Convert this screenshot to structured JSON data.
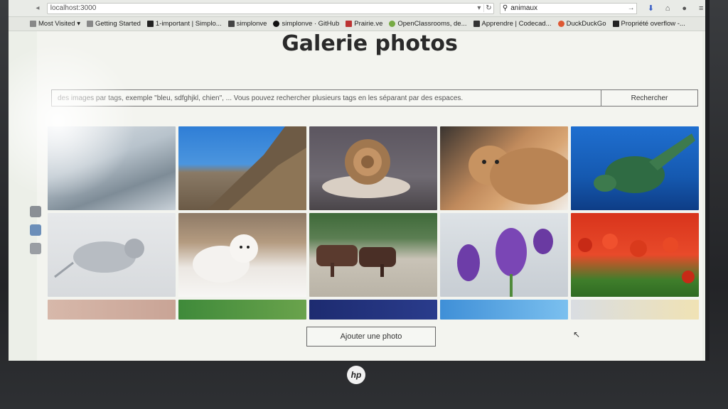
{
  "browser": {
    "url": "localhost:3000",
    "search_value": "animaux",
    "bookmarks": [
      "Most Visited",
      "Getting Started",
      "1-important | Simplo...",
      "simplonve",
      "simplonve · GitHub",
      "Prairie.ve",
      "OpenClassrooms, de...",
      "Apprendre | Codecad...",
      "DuckDuckGo",
      "Propriété overflow -..."
    ]
  },
  "page": {
    "title": "Galerie photos",
    "search_placeholder": "des images par tags, exemple \"bleu, sdfghjkl, chien\", ... Vous pouvez rechercher plusieurs tags en les séparant par des espaces.",
    "search_button": "Rechercher",
    "add_button": "Ajouter une photo"
  },
  "gallery": {
    "rows": [
      [
        "snow-rocks",
        "cliff-goat",
        "snail",
        "cougar",
        "sea-turtle"
      ],
      [
        "mouse",
        "polar-bear-cub",
        "cattle",
        "purple-tulips",
        "red-tulips"
      ],
      [
        "strip-1",
        "strip-2",
        "strip-3",
        "strip-4",
        "strip-5"
      ]
    ]
  },
  "device": {
    "logo": "hp"
  }
}
